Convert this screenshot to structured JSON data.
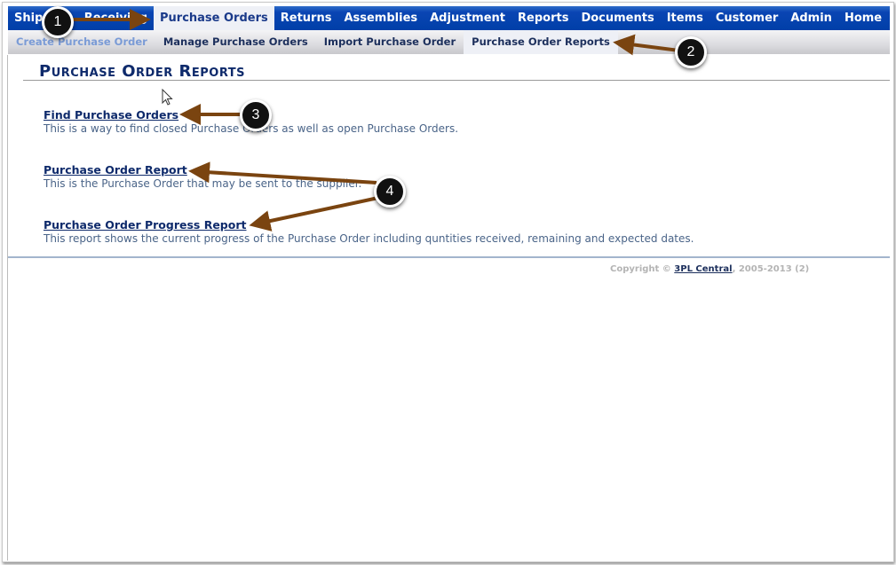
{
  "top_nav": {
    "items": [
      {
        "label": "Shipping"
      },
      {
        "label": "Receiving"
      },
      {
        "label": "Purchase Orders",
        "active": true
      },
      {
        "label": "Returns"
      },
      {
        "label": "Assemblies"
      },
      {
        "label": "Adjustment"
      },
      {
        "label": "Reports"
      },
      {
        "label": "Documents"
      },
      {
        "label": "Items"
      },
      {
        "label": "Customer"
      },
      {
        "label": "Admin"
      },
      {
        "label": "Home"
      }
    ]
  },
  "sub_nav": {
    "items": [
      {
        "label": "Create Purchase Order"
      },
      {
        "label": "Manage Purchase Orders"
      },
      {
        "label": "Import Purchase Order"
      },
      {
        "label": "Purchase Order Reports",
        "active": true
      }
    ]
  },
  "page": {
    "title": "Purchase Order Reports",
    "reports": [
      {
        "link": "Find Purchase Orders",
        "description": "This is a way to find closed Purchase Orders as well as open Purchase Orders."
      },
      {
        "link": "Purchase Order Report",
        "description": "This is the Purchase Order that may be sent to the supplier."
      },
      {
        "link": "Purchase Order Progress Report",
        "description": "This report shows the current progress of the Purchase Order including quntities received, remaining and expected dates."
      }
    ]
  },
  "footer": {
    "copyright_prefix": "Copyright ©",
    "company_link": "3PL Central",
    "copyright_suffix": ", 2005-2013 (2)"
  },
  "annotations": {
    "colors": {
      "arrow": "#7a4410",
      "badge": "#111111"
    },
    "badges": [
      "1",
      "2",
      "3",
      "4"
    ]
  }
}
